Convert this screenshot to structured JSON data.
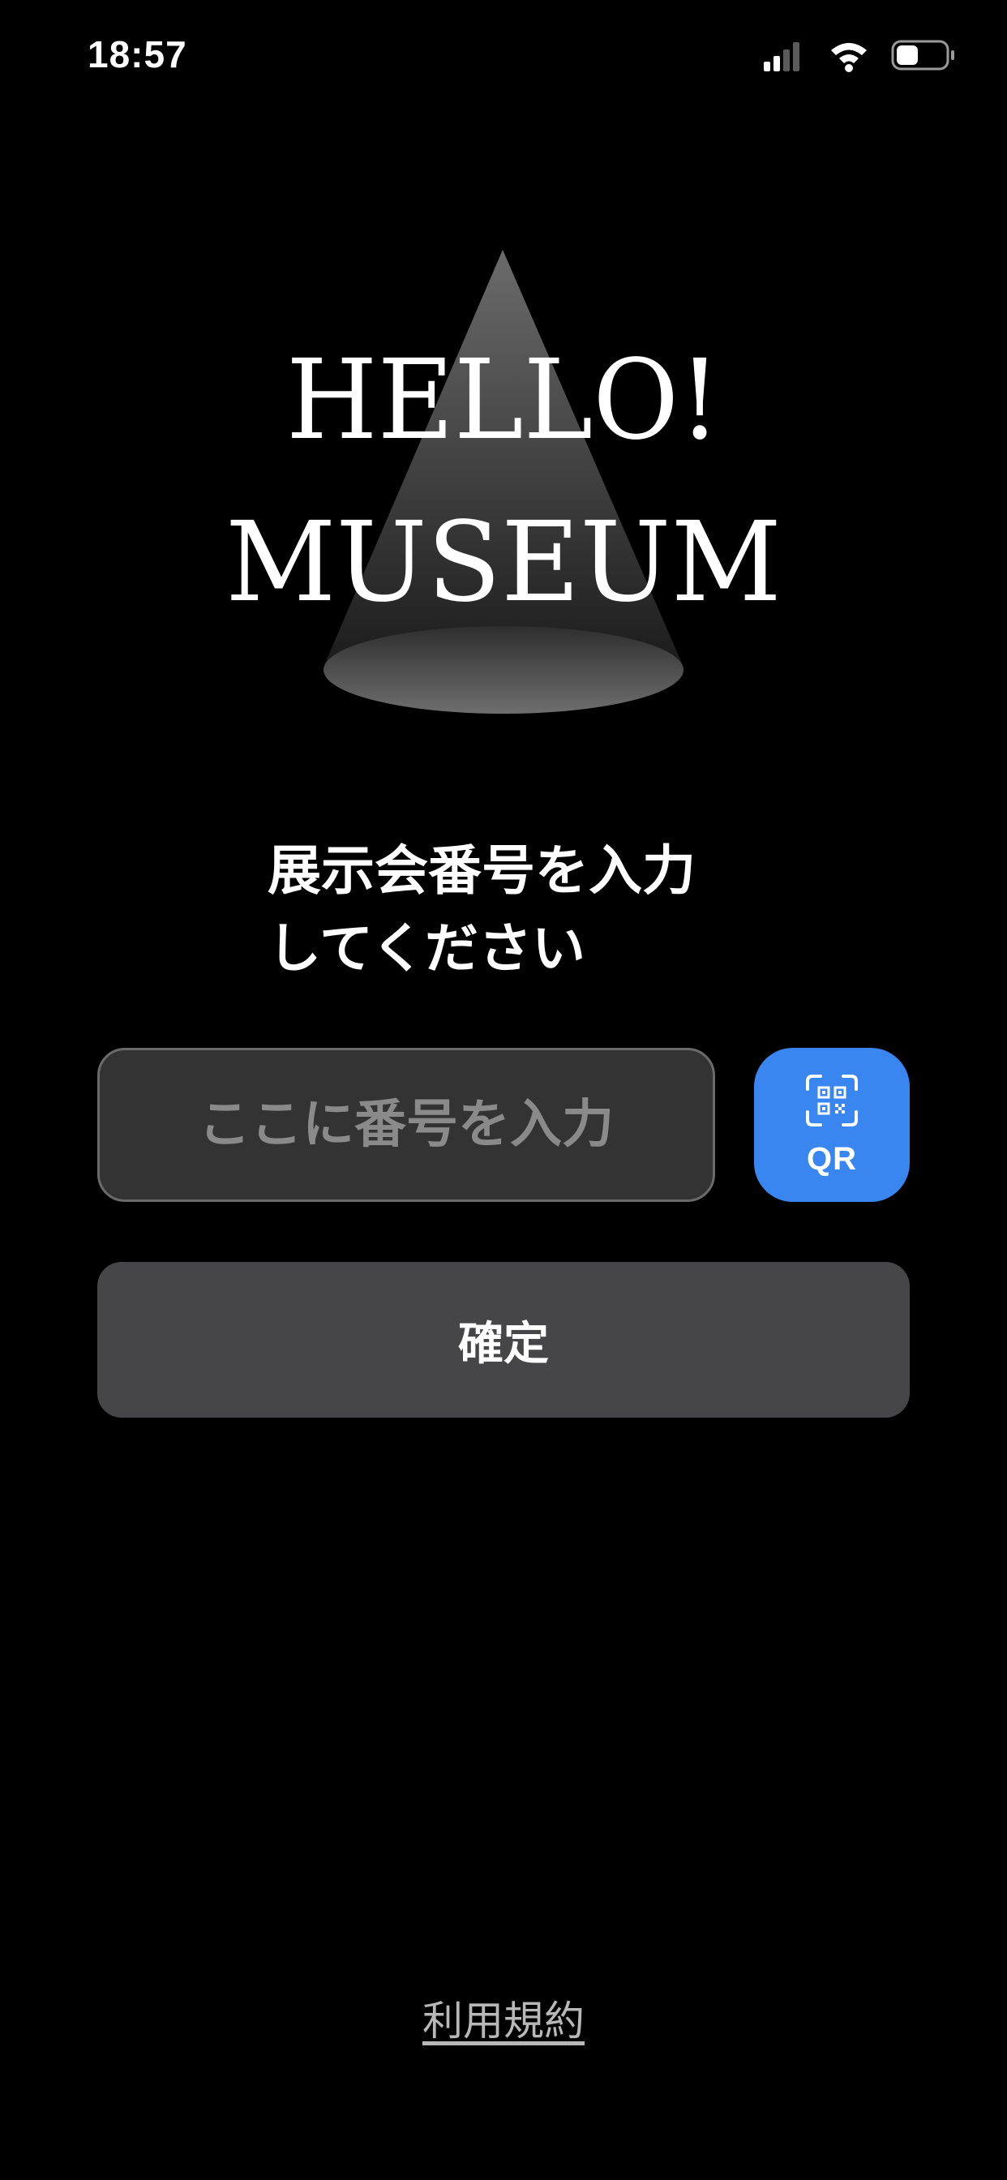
{
  "status_bar": {
    "time": "18:57",
    "icons": [
      "cellular-signal-icon",
      "wifi-icon",
      "battery-icon"
    ]
  },
  "logo": {
    "line1": "HELLO!",
    "line2": "MUSEUM"
  },
  "prompt": {
    "line1": "展示会番号を入力",
    "line2": "してください"
  },
  "number_input": {
    "value": "",
    "placeholder": "ここに番号を入力"
  },
  "qr_button": {
    "label": "QR",
    "icon": "qr-scan-icon"
  },
  "confirm_button": {
    "label": "確定"
  },
  "footer": {
    "terms_label": "利用規約"
  },
  "colors": {
    "background": "#000000",
    "accent": "#3a86f0",
    "input_bg": "#333333",
    "button_bg": "#464648",
    "placeholder": "#8a8a8a",
    "link": "#b8b8b8"
  }
}
